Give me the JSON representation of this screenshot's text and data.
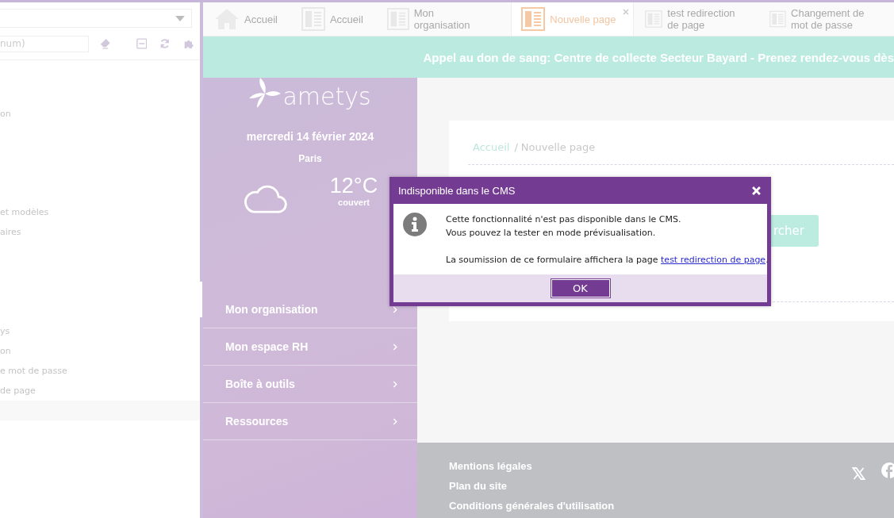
{
  "explorer": {
    "search": {
      "placeholder": "num)"
    },
    "tree_items": [
      {
        "label": "on"
      },
      {
        "label": "et modèles"
      },
      {
        "label": "aires"
      },
      {
        "label": "ys"
      },
      {
        "label": "on"
      },
      {
        "label": "e mot de passe"
      },
      {
        "label": "de page"
      }
    ]
  },
  "tabs": [
    {
      "label": "Accueil",
      "kind": "home",
      "selected": false,
      "closable": false
    },
    {
      "label": "Accueil",
      "kind": "page",
      "selected": false,
      "closable": false
    },
    {
      "label": "Mon organisation",
      "kind": "page",
      "selected": false,
      "closable": false
    },
    {
      "label": "Nouvelle page",
      "kind": "page",
      "selected": true,
      "closable": true
    },
    {
      "label": "test redirection de page",
      "kind": "page",
      "selected": false,
      "closable": false
    },
    {
      "label": "Changement de mot de passe",
      "kind": "page",
      "selected": false,
      "closable": false
    }
  ],
  "banner": {
    "text": "**Appel au don de sang:** Centre de collecte Secteur Bayard - Prenez rendez-vous dès"
  },
  "site": {
    "logo": "ametys",
    "date": "mercredi 14 février 2024",
    "city": "Paris",
    "temperature": "12°C",
    "weather": "couvert",
    "nav": [
      "Mon organisation",
      "Mon espace RH",
      "Boîte à outils",
      "Ressources"
    ]
  },
  "content": {
    "breadcrumb": {
      "items": [
        "Accueil",
        "Nouvelle page"
      ],
      "separator": "/"
    },
    "search_button": "rcher"
  },
  "footer": {
    "links": [
      "Mentions légales",
      "Plan du site",
      "Conditions générales d'utilisation"
    ]
  },
  "dialog": {
    "title": "Indisponible dans le CMS",
    "lines": [
      "Cette fonctionnalité n'est pas disponible dans le CMS.",
      "Vous pouvez la tester en mode prévisualisation."
    ],
    "note": "La soumission de ce formulaire affichera la page",
    "link": "test redirection de page",
    "note_end": ".",
    "button": "OK"
  }
}
